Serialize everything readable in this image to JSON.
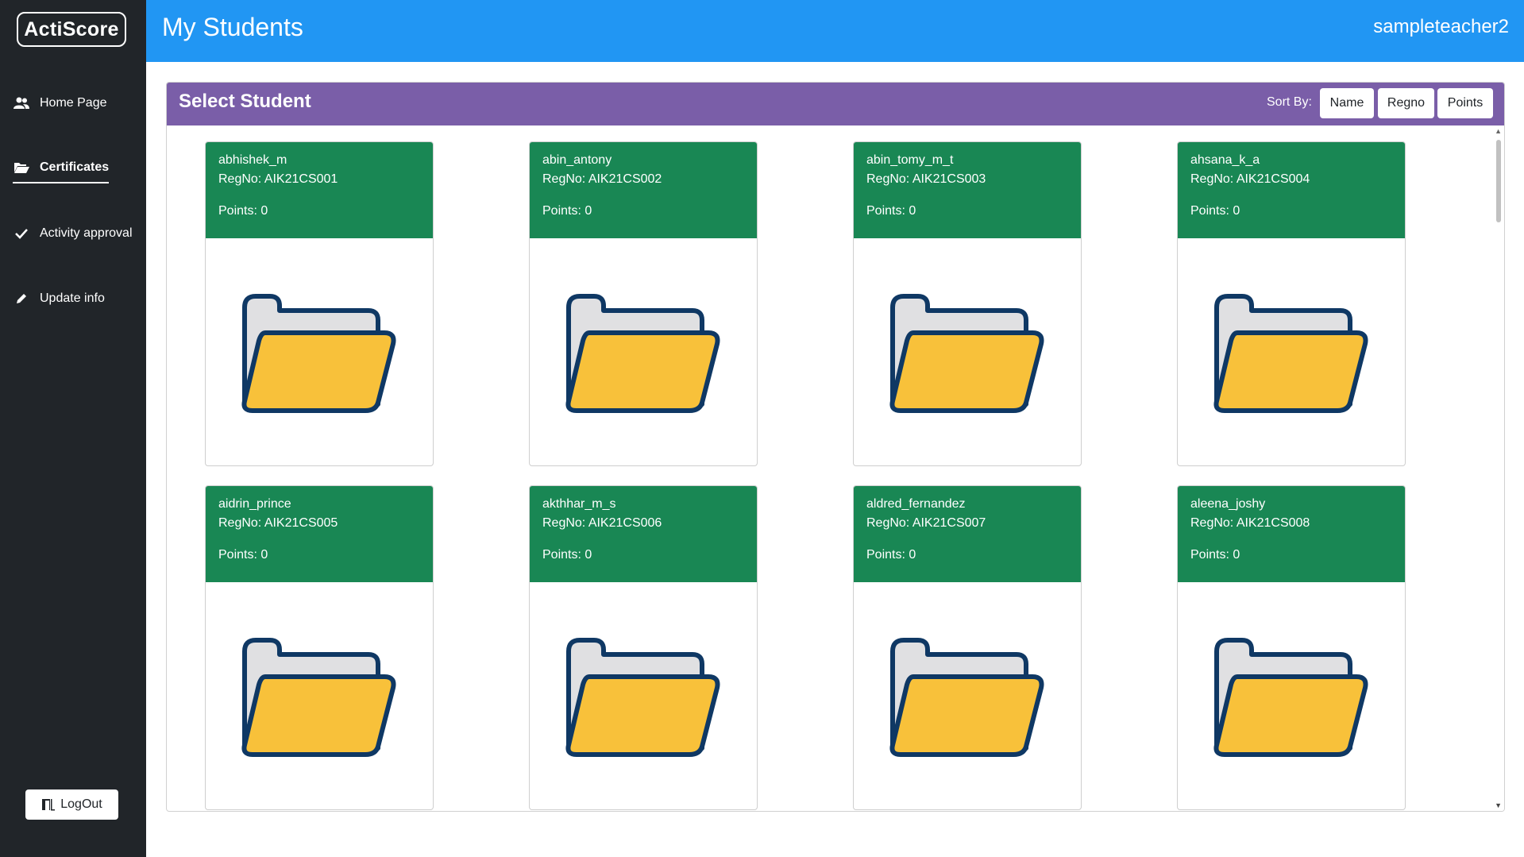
{
  "app": {
    "logo": "ActiScore"
  },
  "sidebar": {
    "items": [
      {
        "label": "Home Page",
        "icon": "users-icon"
      },
      {
        "label": "Certificates",
        "icon": "folder-open-icon"
      },
      {
        "label": "Activity approval",
        "icon": "check-icon"
      },
      {
        "label": "Update info",
        "icon": "pencil-icon"
      }
    ],
    "logout_label": "LogOut"
  },
  "header": {
    "title": "My Students",
    "username": "sampleteacher2"
  },
  "panel": {
    "title": "Select Student",
    "sort_label": "Sort By:",
    "sort_buttons": [
      "Name",
      "Regno",
      "Points"
    ]
  },
  "students": [
    {
      "name": "abhishek_m",
      "regno": "RegNo: AIK21CS001",
      "points": "Points: 0"
    },
    {
      "name": "abin_antony",
      "regno": "RegNo: AIK21CS002",
      "points": "Points: 0"
    },
    {
      "name": "abin_tomy_m_t",
      "regno": "RegNo: AIK21CS003",
      "points": "Points: 0"
    },
    {
      "name": "ahsana_k_a",
      "regno": "RegNo: AIK21CS004",
      "points": "Points: 0"
    },
    {
      "name": "aidrin_prince",
      "regno": "RegNo: AIK21CS005",
      "points": "Points: 0"
    },
    {
      "name": "akthhar_m_s",
      "regno": "RegNo: AIK21CS006",
      "points": "Points: 0"
    },
    {
      "name": "aldred_fernandez",
      "regno": "RegNo: AIK21CS007",
      "points": "Points: 0"
    },
    {
      "name": "aleena_joshy",
      "regno": "RegNo: AIK21CS008",
      "points": "Points: 0"
    }
  ],
  "colors": {
    "sidebar": "#212529",
    "topbar": "#2196f3",
    "panel_header": "#7a5ea8",
    "card_header": "#198754",
    "folder_fill": "#f8c13a",
    "folder_back": "#e0e0e2",
    "folder_stroke": "#0f3864"
  }
}
